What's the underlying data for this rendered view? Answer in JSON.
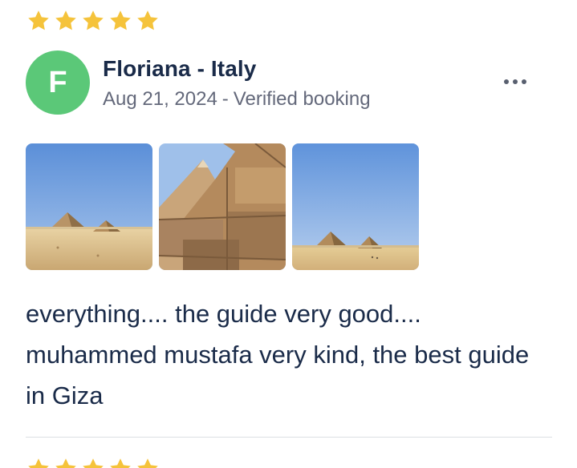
{
  "review": {
    "rating": 5,
    "star_color": "#f5c33b",
    "avatar_initial": "F",
    "avatar_color": "#5bc878",
    "author": "Floriana - Italy",
    "date": "Aug 21, 2024",
    "separator": "-",
    "verified_label": "Verified booking",
    "more_icon": "more-horizontal-icon",
    "photos": [
      {
        "subject": "pyramids-desert-view"
      },
      {
        "subject": "pyramid-stone-blocks"
      },
      {
        "subject": "pyramids-distant-view"
      }
    ],
    "text": "everything.... the guide very good.... muhammed mustafa very kind, the best guide in Giza"
  },
  "next_review": {
    "rating": 5,
    "star_color": "#f5c33b"
  }
}
